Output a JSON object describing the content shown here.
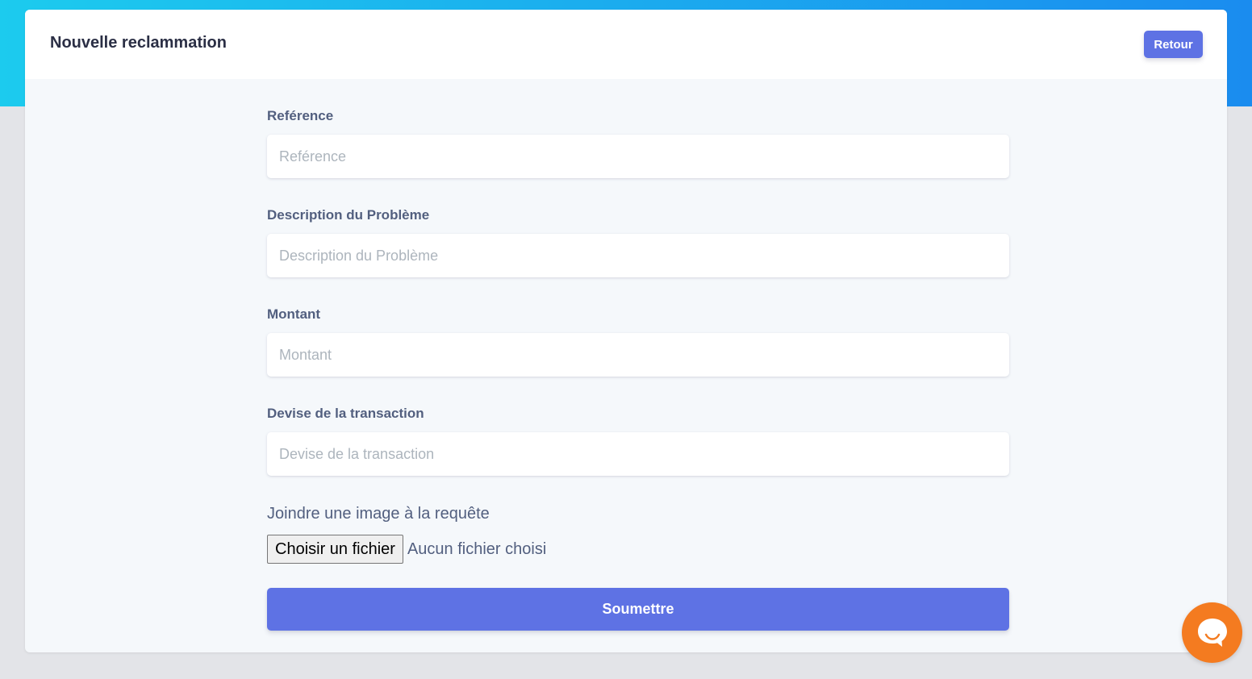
{
  "header": {
    "title": "Nouvelle reclammation",
    "back_label": "Retour"
  },
  "form": {
    "reference": {
      "label": "Reférence",
      "placeholder": "Reférence",
      "value": ""
    },
    "description": {
      "label": "Description du Problème",
      "placeholder": "Description du Problème",
      "value": ""
    },
    "amount": {
      "label": "Montant",
      "placeholder": "Montant",
      "value": ""
    },
    "currency": {
      "label": "Devise de la transaction",
      "placeholder": "Devise de la transaction",
      "value": ""
    },
    "attachment": {
      "label": "Joindre une image à la requête",
      "button_label": "Choisir un fichier",
      "status": "Aucun fichier choisi"
    },
    "submit_label": "Soumettre"
  },
  "chat_widget": {
    "icon": "chat-bubble-icon"
  },
  "colors": {
    "accent": "#5e72e4",
    "header_gradient_start": "#1ccbee",
    "header_gradient_end": "#1a8cef",
    "chat_widget": "#f47b20",
    "label_text": "#525f7f",
    "page_background": "#e3e4e8"
  }
}
